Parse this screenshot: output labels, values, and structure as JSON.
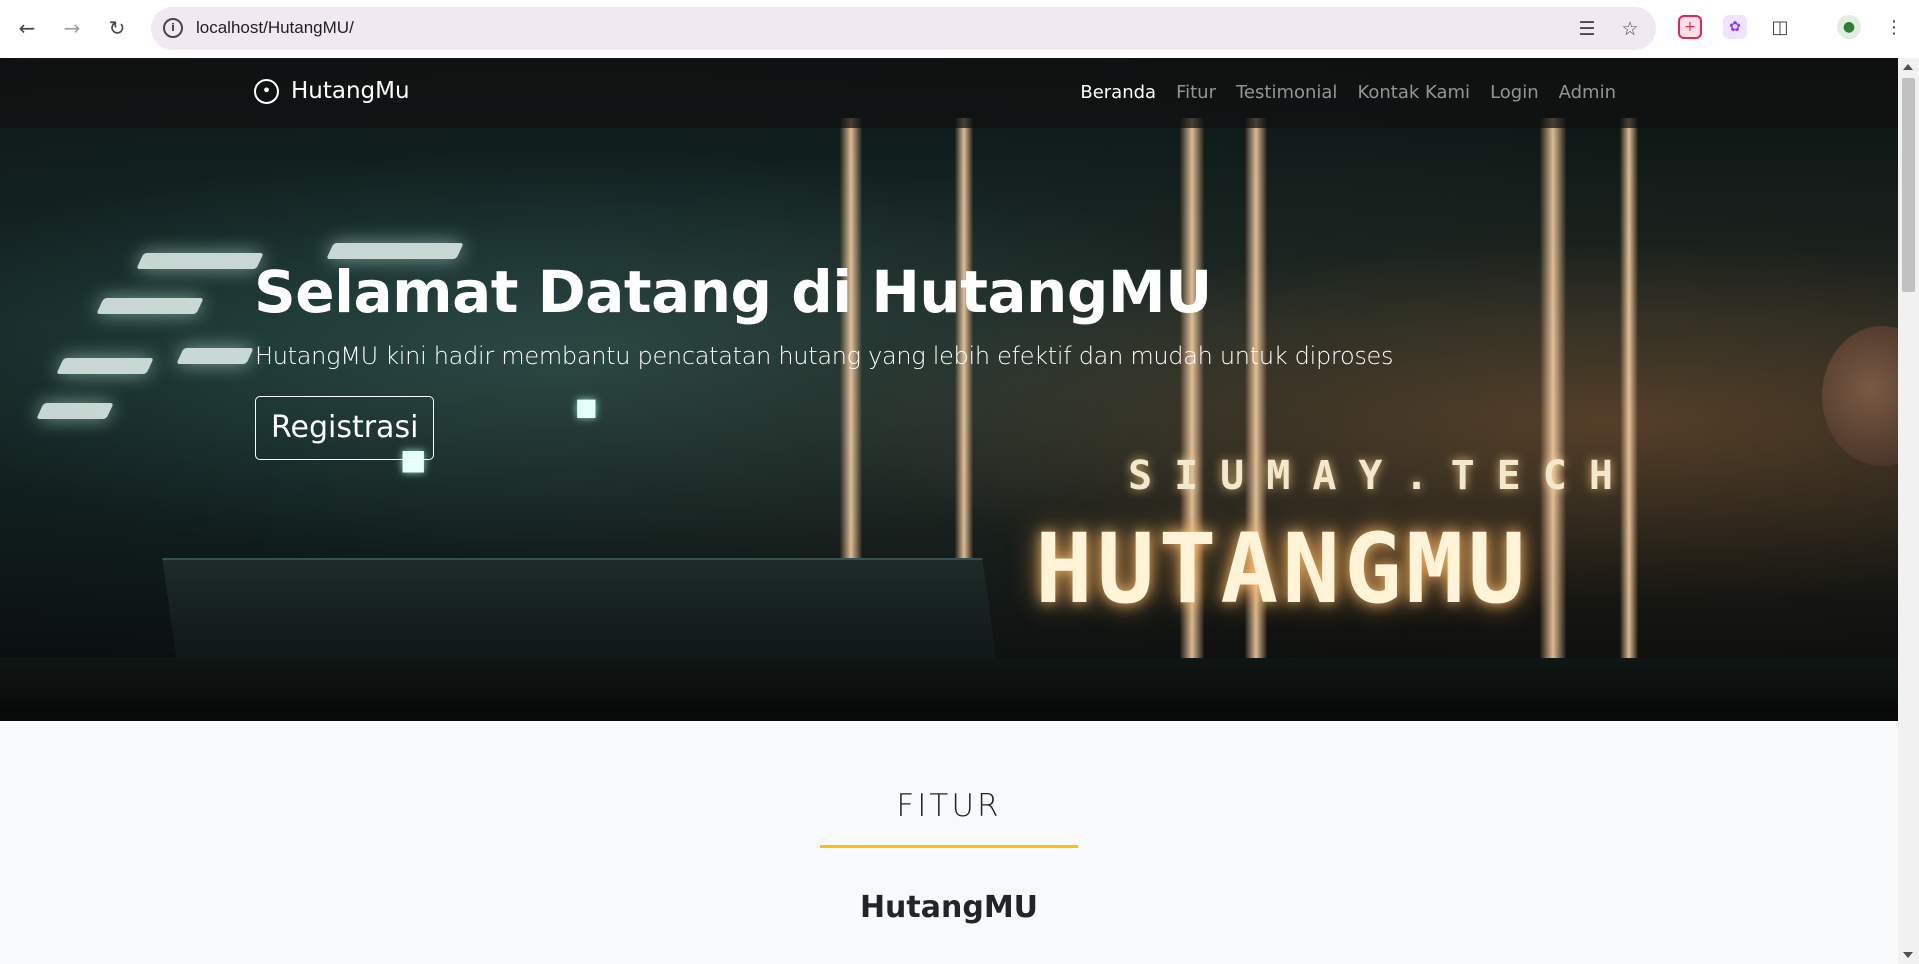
{
  "browser": {
    "url": "localhost/HutangMU/",
    "back_icon": "arrow-left-icon",
    "forward_icon": "arrow-right-icon",
    "reload_icon": "reload-icon"
  },
  "navbar": {
    "brand": "HutangMu",
    "links": [
      {
        "label": "Beranda",
        "active": true
      },
      {
        "label": "Fitur",
        "active": false
      },
      {
        "label": "Testimonial",
        "active": false
      },
      {
        "label": "Kontak Kami",
        "active": false
      },
      {
        "label": "Login",
        "active": false
      },
      {
        "label": "Admin",
        "active": false
      }
    ]
  },
  "hero": {
    "title": "Selamat Datang di HutangMU",
    "subtitle": "HutangMU kini hadir membantu pencatatan hutang yang lebih efektif dan mudah untuk diproses",
    "button": "Registrasi",
    "image_text_small": "SIUMAY.TECH",
    "image_text_big": "HUTANGMU"
  },
  "features": {
    "heading": "FITUR",
    "subheading": "HutangMU"
  },
  "colors": {
    "accent_line": "#ffc107",
    "navbar_bg": "#111111"
  }
}
